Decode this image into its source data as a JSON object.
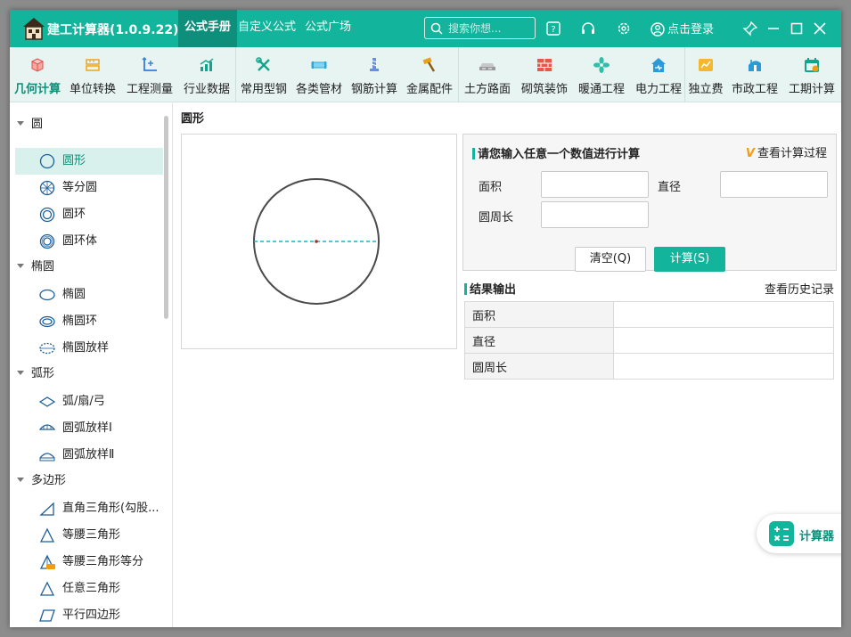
{
  "app": {
    "title": "建工计算器(1.0.9.22)",
    "tabs": [
      "公式手册",
      "自定义公式",
      "公式广场"
    ],
    "search_placeholder": "搜索你想...",
    "login_label": "点击登录",
    "accent_color": "#13b49c"
  },
  "ribbon": [
    {
      "label": "几何计算",
      "icon": "cube-icon"
    },
    {
      "label": "单位转换",
      "icon": "ruler-convert-icon"
    },
    {
      "label": "工程测量",
      "icon": "axis-measure-icon"
    },
    {
      "label": "行业数据",
      "icon": "bar-chart-icon"
    },
    {
      "label": "常用型钢",
      "icon": "tools-icon"
    },
    {
      "label": "各类管材",
      "icon": "pipe-icon"
    },
    {
      "label": "钢筋计算",
      "icon": "rebar-icon"
    },
    {
      "label": "金属配件",
      "icon": "hammer-icon"
    },
    {
      "label": "土方路面",
      "icon": "road-icon"
    },
    {
      "label": "砌筑装饰",
      "icon": "brick-icon"
    },
    {
      "label": "暖通工程",
      "icon": "fan-icon"
    },
    {
      "label": "电力工程",
      "icon": "power-house-icon"
    },
    {
      "label": "独立费",
      "icon": "fee-chart-icon"
    },
    {
      "label": "市政工程",
      "icon": "municipal-icon"
    },
    {
      "label": "工期计算",
      "icon": "calendar-icon"
    }
  ],
  "sidebar": {
    "groups": [
      {
        "label": "圆",
        "items": [
          {
            "label": "圆形",
            "icon": "circle-icon"
          },
          {
            "label": "等分圆",
            "icon": "divided-circle-icon"
          },
          {
            "label": "圆环",
            "icon": "ring-icon"
          },
          {
            "label": "圆环体",
            "icon": "torus-icon"
          }
        ]
      },
      {
        "label": "椭圆",
        "items": [
          {
            "label": "椭圆",
            "icon": "ellipse-icon"
          },
          {
            "label": "椭圆环",
            "icon": "ellipse-ring-icon"
          },
          {
            "label": "椭圆放样",
            "icon": "ellipse-lofting-icon"
          }
        ]
      },
      {
        "label": "弧形",
        "items": [
          {
            "label": "弧/扇/弓",
            "icon": "arc-sector-icon"
          },
          {
            "label": "圆弧放样Ⅰ",
            "icon": "arc-lofting-1-icon"
          },
          {
            "label": "圆弧放样Ⅱ",
            "icon": "arc-lofting-2-icon"
          }
        ]
      },
      {
        "label": "多边形",
        "items": [
          {
            "label": "直角三角形(勾股...",
            "icon": "right-triangle-icon"
          },
          {
            "label": "等腰三角形",
            "icon": "isosceles-triangle-icon"
          },
          {
            "label": "等腰三角形等分",
            "icon": "triangle-vip-icon"
          },
          {
            "label": "任意三角形",
            "icon": "triangle-icon"
          },
          {
            "label": "平行四边形",
            "icon": "parallelogram-icon"
          }
        ]
      }
    ]
  },
  "main": {
    "page_title": "圆形",
    "input_panel": {
      "title": "请您输入任意一个数值进行计算",
      "vip_badge": "V",
      "view_process_label": "查看计算过程",
      "fields": [
        {
          "label": "面积",
          "value": ""
        },
        {
          "label": "直径",
          "value": ""
        },
        {
          "label": "圆周长",
          "value": ""
        }
      ],
      "clear_button": "清空(Q)",
      "calc_button": "计算(S)"
    },
    "results": {
      "title": "结果输出",
      "history_link": "查看历史记录",
      "rows": [
        {
          "label": "面积",
          "value": ""
        },
        {
          "label": "直径",
          "value": ""
        },
        {
          "label": "圆周长",
          "value": ""
        }
      ]
    }
  },
  "floating_button": {
    "label": "计算器",
    "icon": "calculator-icon"
  }
}
